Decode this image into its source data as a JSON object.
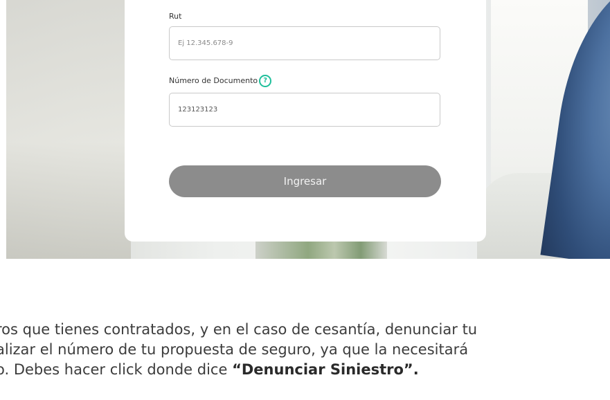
{
  "form": {
    "rut_label": "Rut",
    "rut_placeholder": "Ej 12.345.678-9",
    "rut_value": "",
    "doc_label": "Número de Documento",
    "doc_help_icon": "?",
    "doc_value": "123123123",
    "submit_label": "Ingresar"
  },
  "text": {
    "line1": "ros que tienes contratados, y en el caso de cesantía, denunciar tu",
    "line2": "alizar el número de tu propuesta de seguro, ya que la necesitará",
    "line3_prefix": "o. Debes hacer click donde dice ",
    "line3_strong": "“Denunciar Siniestro”."
  },
  "colors": {
    "accent": "#1fbf9b",
    "button_bg": "#8c8c8c"
  }
}
